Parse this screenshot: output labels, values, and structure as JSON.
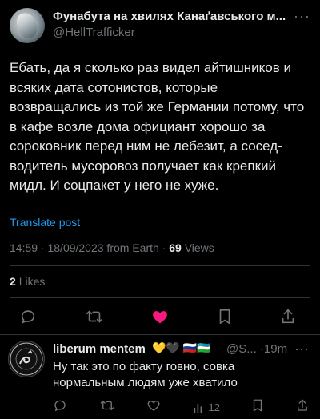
{
  "tweet": {
    "author_name": "Фунабута на хвилях Канаґавського м...",
    "author_handle": "@HellTrafficker",
    "more_label": "···",
    "text": "Ебать, да я сколько раз видел айтишников и всяких дата сотонистов, которые возвращались из той же Германии потому, что в кафе возле дома официант хорошо за сороковник перед ним не лебезит, а сосед-водитель мусоровоз получает как крепкий мидл. И соцпакет у него не хуже.",
    "translate_label": "Translate post",
    "meta_prefix": "14:59 · 18/09/2023 from Earth · ",
    "views_count": "69",
    "views_label": "Views",
    "likes_count": "2",
    "likes_label": "Likes"
  },
  "reply": {
    "author_name": "liberum mentem",
    "badges": "💛🖤 🇷🇺🇺🇿",
    "handle_time": "@S... ·19m",
    "more_label": "···",
    "text": "Ну так это по факту говно, совка нормальным людям уже хватило",
    "views_count": "12"
  },
  "icons": {
    "reply": "comment-icon",
    "retweet": "retweet-icon",
    "like": "heart-icon",
    "bookmark": "bookmark-icon",
    "views": "views-icon",
    "share": "share-icon"
  },
  "colors": {
    "background": "#000000",
    "link": "#1d9bf0",
    "like": "#f91880",
    "muted": "#71767b"
  }
}
